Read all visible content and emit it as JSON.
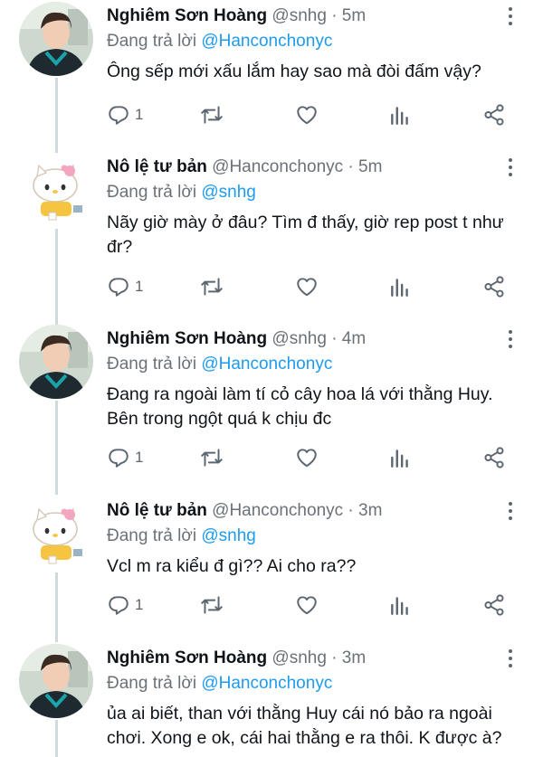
{
  "tweets": [
    {
      "name": "Nghiêm Sơn Hoàng",
      "handle": "@snhg",
      "time": "· 5m",
      "replying_label": "Đang trả lời",
      "replying_to": "@Hanconchonyc",
      "text": "Ông sếp mới xấu lắm hay sao mà đòi đấm vậy?",
      "reply_count": "1",
      "avatar": "boy-avatar"
    },
    {
      "name": "Nô lệ tư bản",
      "handle": "@Hanconchonyc",
      "time": "· 5m",
      "replying_label": "Đang trả lời",
      "replying_to": "@snhg",
      "text": "Nãy giờ mày ở đâu? Tìm đ thấy, giờ rep post t như đr?",
      "reply_count": "1",
      "avatar": "kitty-avatar"
    },
    {
      "name": "Nghiêm Sơn Hoàng",
      "handle": "@snhg",
      "time": "· 4m",
      "replying_label": "Đang trả lời",
      "replying_to": "@Hanconchonyc",
      "text": "Đang ra ngoài làm tí cỏ cây hoa lá với thằng Huy. Bên trong ngột quá k chịu đc",
      "reply_count": "1",
      "avatar": "boy-avatar"
    },
    {
      "name": "Nô lệ tư bản",
      "handle": "@Hanconchonyc",
      "time": "· 3m",
      "replying_label": "Đang trả lời",
      "replying_to": "@snhg",
      "text": "Vcl m ra kiểu đ gì?? Ai cho ra??",
      "reply_count": "1",
      "avatar": "kitty-avatar"
    },
    {
      "name": "Nghiêm Sơn Hoàng",
      "handle": "@snhg",
      "time": "· 3m",
      "replying_label": "Đang trả lời",
      "replying_to": "@Hanconchonyc",
      "text": "ủa ai biết, than với thằng Huy cái nó bảo ra ngoài chơi. Xong e ok, cái hai thằng e ra thôi. K được à?",
      "reply_count": "",
      "avatar": "boy-avatar"
    }
  ],
  "icons": {
    "reply": "reply-icon",
    "retweet": "retweet-icon",
    "like": "heart-icon",
    "stats": "stats-icon",
    "share": "share-icon",
    "more": "more-icon"
  },
  "colors": {
    "link": "#1d9bf0",
    "secondary_text": "#6a7278",
    "thread_line": "#cfd9de"
  }
}
